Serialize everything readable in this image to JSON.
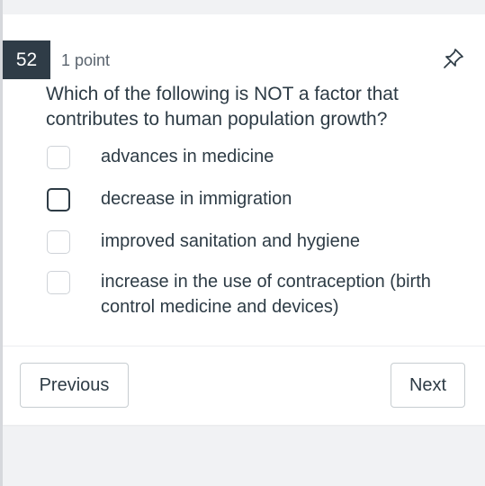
{
  "question": {
    "number": "52",
    "points": "1 point",
    "text": "Which of the following is NOT a factor that contributes to human population growth?",
    "options": [
      {
        "label": "advances in medicine"
      },
      {
        "label": "decrease in immigration"
      },
      {
        "label": "improved sanitation and hygiene"
      },
      {
        "label": "increase in the use of contraception (birth control medicine and devices)"
      }
    ],
    "flag_icon": "pin-icon"
  },
  "navigation": {
    "previous_label": "Previous",
    "next_label": "Next"
  },
  "colors": {
    "number_badge_bg": "#2f3c47",
    "text": "#2d3b45",
    "muted_text": "#5a646e",
    "border": "#c7cdd1",
    "page_bg": "#f1f2f4"
  }
}
